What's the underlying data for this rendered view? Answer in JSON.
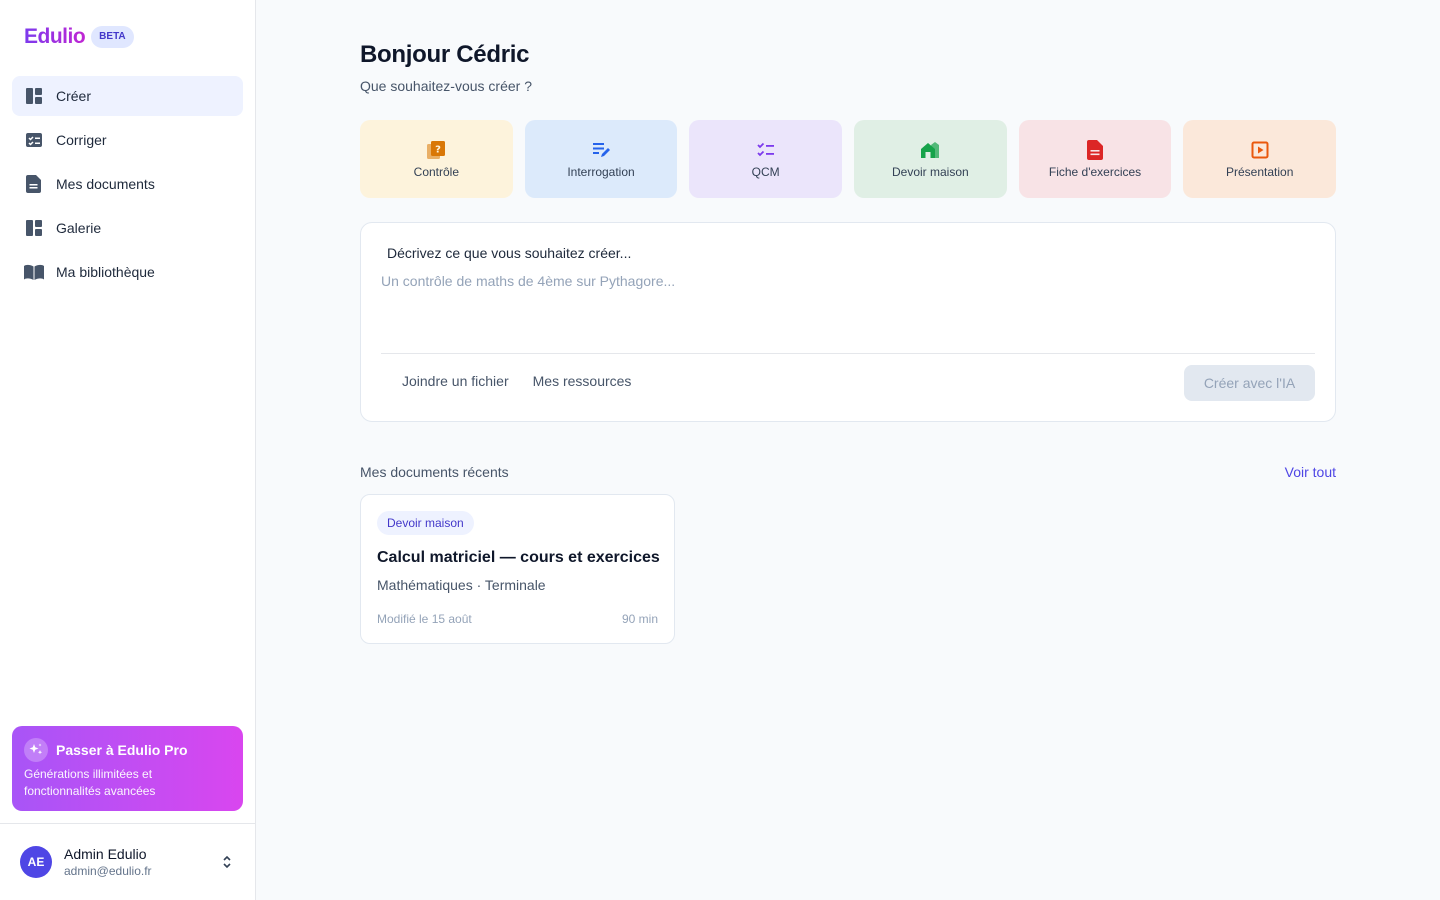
{
  "app": {
    "name": "Edulio",
    "badge": "BETA"
  },
  "sidebar": {
    "items": [
      {
        "label": "Créer",
        "suffix": "",
        "icon": "dashboard-icon",
        "active": true
      },
      {
        "label": "Corriger",
        "suffix": "",
        "icon": "checklist-icon",
        "active": false
      },
      {
        "label": "Mes documents",
        "suffix": "",
        "icon": "document-icon",
        "active": false
      },
      {
        "label": "Galerie",
        "suffix": "",
        "icon": "gallery-icon",
        "active": false
      },
      {
        "label": "Ma bibliothèque",
        "suffix": "",
        "icon": "library-icon",
        "active": false
      }
    ],
    "promo": {
      "title": "Passer à Edulio Pro",
      "description": "Générations illimitées et fonctionnalités avancées"
    },
    "user": {
      "initials": "AE",
      "name": "Admin Edulio",
      "email": "admin@edulio.fr"
    }
  },
  "main": {
    "greeting": "Bonjour Cédric",
    "subtitle": "Que souhaitez-vous créer ?",
    "types": [
      {
        "label": "Contrôle",
        "icon": "quiz-icon",
        "bg": "#fdf3dc",
        "color": "#d97706"
      },
      {
        "label": "Interrogation",
        "icon": "edit-note-icon",
        "bg": "#dceafb",
        "color": "#2563eb"
      },
      {
        "label": "QCM",
        "icon": "checklist-icon",
        "bg": "#ebe5fb",
        "color": "#7c3aed"
      },
      {
        "label": "Devoir maison",
        "icon": "house-icon",
        "bg": "#e0efe5",
        "color": "#16a34a"
      },
      {
        "label": "Fiche d'exercices",
        "icon": "document-icon",
        "bg": "#f8e3e6",
        "color": "#dc2626"
      },
      {
        "label": "Présentation",
        "icon": "slideshow-icon",
        "bg": "#fbe8da",
        "color": "#ea580c"
      }
    ],
    "prompt": {
      "label": "Décrivez ce que vous souhaitez créer...",
      "placeholder": "Un contrôle de maths de 4ème sur Pythagore...",
      "attach_label": "Joindre un fichier",
      "resources_label": "Mes ressources",
      "glyph": "",
      "submit_label": " Créer avec l'IA"
    },
    "recent": {
      "title": "Mes documents récents",
      "see_all": "Voir tout",
      "documents": [
        {
          "badge": "Devoir maison",
          "title": "Calcul matriciel — cours et exercices",
          "meta": "Mathématiques · Terminale",
          "modified": "Modifié le 15 août",
          "duration": "90 min"
        }
      ]
    }
  },
  "colors": {
    "accent": "#4f46e5",
    "active_bg": "#eef2ff",
    "promo_from": "#a855f7",
    "promo_to": "#d946ef"
  }
}
